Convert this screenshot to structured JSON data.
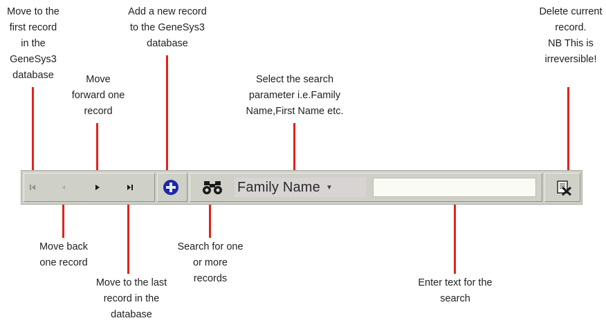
{
  "annotations": {
    "first_record": "Move to the\nfirst record\nin the\nGeneSys3\ndatabase",
    "forward": "Move\nforward one\nrecord",
    "add_record": "Add a new record\nto the GeneSys3\ndatabase",
    "search_param": "Select the search\nparameter  i.e.Family\nName,First Name etc.",
    "delete": "Delete current\nrecord.\nNB This is\nirreversible!",
    "back": "Move back\none record",
    "search_records": "Search for one\nor more\nrecords",
    "last_record": "Move to the last\nrecord in the\ndatabase",
    "enter_text": "Enter text for the\nsearch"
  },
  "toolbar": {
    "search_field_label": "Family Name",
    "search_text_value": ""
  },
  "colors": {
    "callout_line": "#e0231b",
    "toolbar_bg": "#cfd0c8",
    "add_button": "#1c28a8"
  },
  "icons": [
    "first-record-icon",
    "previous-record-icon",
    "next-record-icon",
    "last-record-icon",
    "add-record-icon",
    "binoculars-icon",
    "dropdown-caret-icon",
    "delete-record-icon"
  ]
}
